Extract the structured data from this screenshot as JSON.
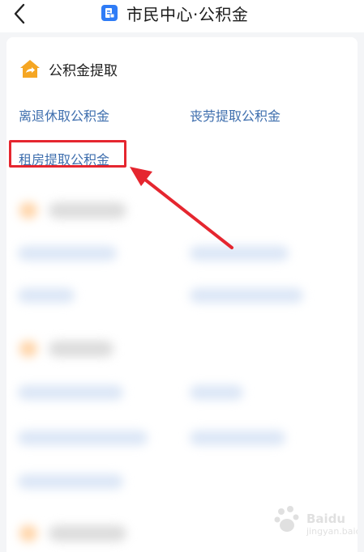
{
  "header": {
    "title": "市民中心·公积金",
    "back_icon": "chevron-left-icon",
    "app_icon": "document-app-icon",
    "brand_color": "#2f7cf6"
  },
  "section": {
    "title": "公积金提取",
    "icon": "house-arrow-icon",
    "icon_color": "#f5a623"
  },
  "links": [
    {
      "label": "离退休取公积金"
    },
    {
      "label": "丧劳提取公积金"
    },
    {
      "label": "租房提取公积金"
    }
  ],
  "annotation": {
    "highlight_color": "#e5262f",
    "target": "租房提取公积金"
  },
  "watermark": {
    "brand": "Baidu",
    "sub": "jingyan.baidu.com"
  }
}
